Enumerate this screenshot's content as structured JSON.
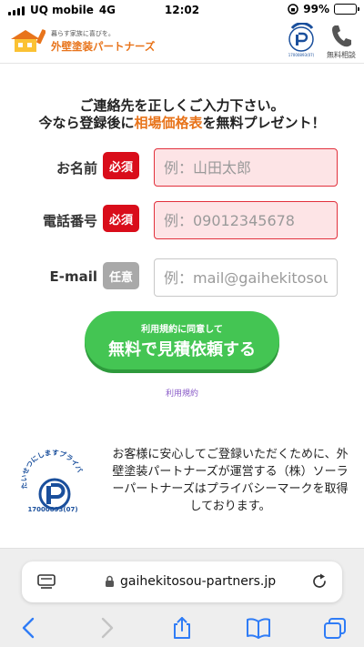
{
  "status_bar": {
    "carrier": "UQ mobile",
    "network": "4G",
    "time": "12:02",
    "battery": "99%"
  },
  "header": {
    "logo_tagline": "暮らす家族に喜びを。",
    "logo_name": "外壁塗装パートナーズ",
    "phone_label": "無料相談"
  },
  "headline": {
    "line1": "ご連絡先を正しくご入力下さい。",
    "line2_before": "今なら登録後に",
    "line2_highlight": "相場価格表",
    "line2_after": "を無料プレゼント！"
  },
  "form": {
    "fields": [
      {
        "label": "お名前",
        "badge": "必須",
        "placeholder": "例：山田太郎"
      },
      {
        "label": "電話番号",
        "badge": "必須",
        "placeholder": "例：09012345678"
      },
      {
        "label": "E-mail",
        "badge": "任意",
        "placeholder": "例：mail@gaihekitosou.jp"
      }
    ],
    "submit_sub": "利用規約に同意して",
    "submit_main": "無料で見積依頼する",
    "terms_link": "利用規約"
  },
  "privacy": {
    "pmark_number": "17000893(07)",
    "pmark_arc_text": "たいせつにしますプライバシー",
    "text": "お客様に安心してご登録いただくために、外壁塗装パートナーズが運営する（株）ソーラーパートナーズはプライバシーマークを取得しております。"
  },
  "browser": {
    "url": "gaihekitosou-partners.jp"
  },
  "colors": {
    "accent_orange": "#e8741b",
    "required_red": "#d90d1a",
    "submit_green": "#44c553",
    "safari_blue": "#2f7cf6"
  }
}
